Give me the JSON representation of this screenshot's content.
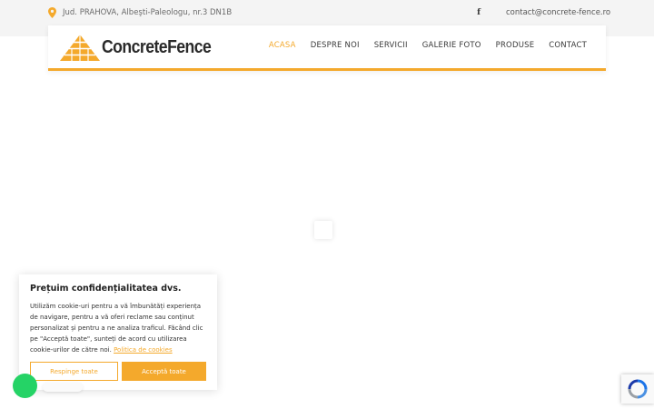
{
  "topbar": {
    "address": "Jud. PRAHOVA, Albeşti-Paleologu, nr.3 DN1B",
    "address_icon": "location-pin-icon",
    "social_icon": "facebook-icon",
    "social_glyph": "f",
    "email": "contact@concrete-fence.ro"
  },
  "logo": {
    "text": "ConcreteFence"
  },
  "nav": {
    "items": [
      "ACASA",
      "DESPRE NOI",
      "SERVICII",
      "GALERIE FOTO",
      "PRODUSE",
      "CONTACT"
    ],
    "active": "ACASA"
  },
  "cookie": {
    "title": "Prețuim confidențialitatea dvs.",
    "text": "Utilizăm cookie-uri pentru a vă îmbunătăți experiența de navigare, pentru a vă oferi reclame sau conținut personalizat și pentru a ne analiza traficul. Făcând clic pe \"Acceptă toate\", sunteți de acord cu utilizarea cookie-urilor de către noi.",
    "policy_link": "Politica de cookies",
    "reject_label": "Respinge toate",
    "accept_label": "Acceptă toate"
  },
  "colors": {
    "accent": "#f4a92c",
    "topbar_bg": "#f4f4f4",
    "whatsapp": "#25d366"
  }
}
